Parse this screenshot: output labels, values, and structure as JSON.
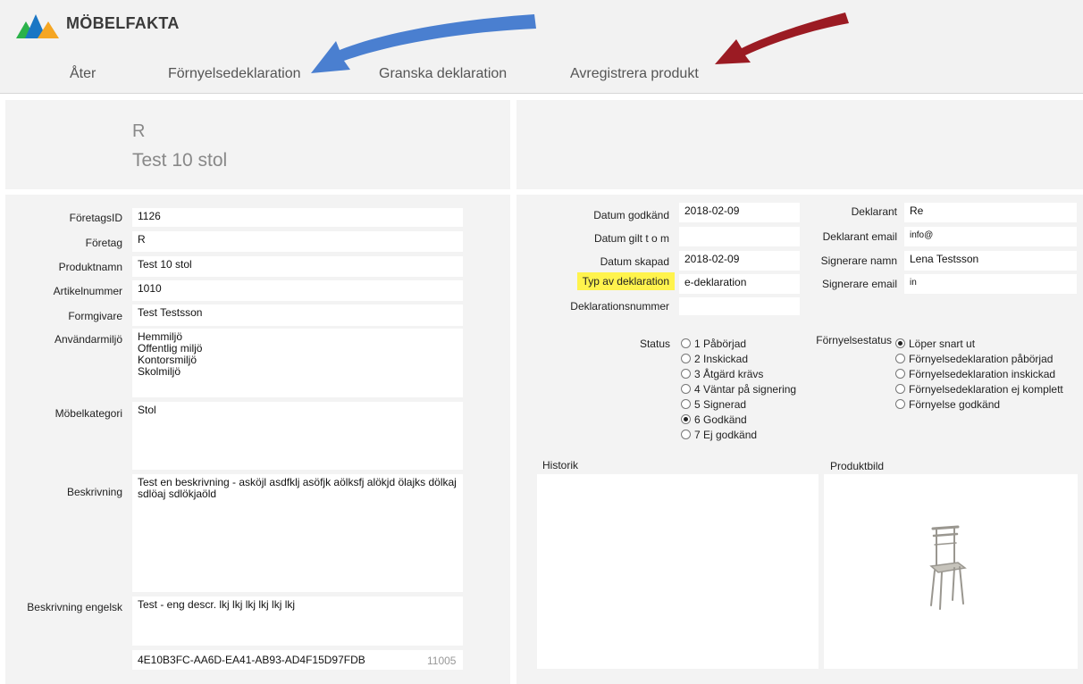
{
  "brand": {
    "name": "MÖBELFAKTA"
  },
  "nav": {
    "back": "Åter",
    "renewal": "Förnyelsedeklaration",
    "review": "Granska deklaration",
    "deregister": "Avregistrera produkt"
  },
  "title": {
    "letter": "R",
    "product": "Test 10 stol"
  },
  "left": {
    "company_id": {
      "label": "FöretagsID",
      "value": "1126"
    },
    "company": {
      "label": "Företag",
      "value": "R"
    },
    "product_name": {
      "label": "Produktnamn",
      "value": "Test 10 stol"
    },
    "article_number": {
      "label": "Artikelnummer",
      "value": "1010"
    },
    "designer": {
      "label": "Formgivare",
      "value": "Test Testsson"
    },
    "user_environment": {
      "label": "Användarmiljö",
      "value": "Hemmiljö\nOffentlig miljö\nKontorsmiljö\nSkolmiljö"
    },
    "furniture_category": {
      "label": "Möbelkategori",
      "value": "Stol"
    },
    "description": {
      "label": "Beskrivning",
      "value": "Test en beskrivning - asköjl asdfklj asöfjk aölksfj alökjd ölajks dölkaj sdlöaj sdlökjaöld"
    },
    "description_en": {
      "label": "Beskrivning engelsk",
      "value": "Test - eng descr. lkj lkj lkj lkj lkj lkj"
    },
    "guid": "4E10B3FC-AA6D-EA41-AB93-AD4F15D97FDB",
    "record_number": "11005"
  },
  "right": {
    "approved_date": {
      "label": "Datum godkänd",
      "value": "2018-02-09"
    },
    "valid_until": {
      "label": "Datum gilt t o m",
      "value": ""
    },
    "created_date": {
      "label": "Datum skapad",
      "value": "2018-02-09"
    },
    "declaration_type": {
      "label": "Typ av deklaration",
      "value": "e-deklaration"
    },
    "declaration_number": {
      "label": "Deklarationsnummer",
      "value": ""
    },
    "declarant": {
      "label": "Deklarant",
      "value": "Re"
    },
    "declarant_email": {
      "label": "Deklarant email",
      "value": "info@"
    },
    "signer_name": {
      "label": "Signerare namn",
      "value": "Lena Testsson"
    },
    "signer_email": {
      "label": "Signerare email",
      "value": "in"
    },
    "status": {
      "label": "Status",
      "options": [
        "1 Påbörjad",
        "2 Inskickad",
        "3 Åtgärd krävs",
        "4 Väntar på signering",
        "5 Signerad",
        "6 Godkänd",
        "7 Ej godkänd"
      ],
      "selected": 5
    },
    "renewal_status": {
      "label": "Förnyelsestatus",
      "options": [
        "Löper snart ut",
        "Förnyelsedeklaration påbörjad",
        "Förnyelsedeklaration inskickad",
        "Förnyelsedeklaration ej komplett",
        "Förnyelse godkänd"
      ],
      "selected": 0
    },
    "history_label": "Historik",
    "product_image_label": "Produktbild"
  },
  "colors": {
    "highlight": "#fff34d",
    "arrow_blue": "#4a7fd0",
    "arrow_red": "#9b1b23"
  }
}
